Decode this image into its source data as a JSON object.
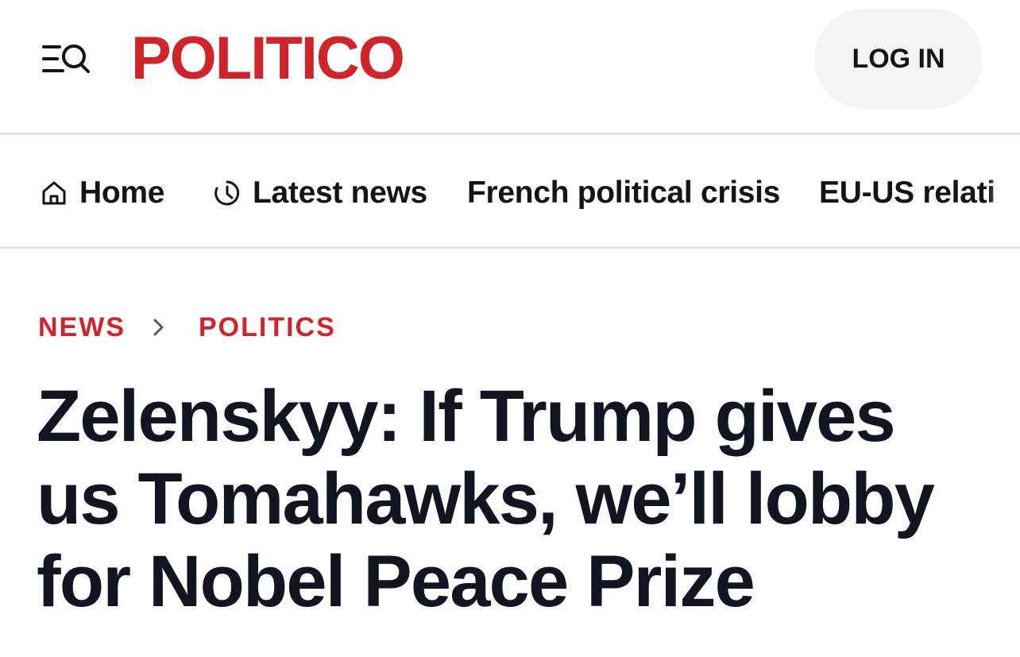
{
  "header": {
    "logo_text": "POLITICO",
    "login_label": "LOG IN",
    "brand_color": "#d0242b",
    "menu_icon": "menu-search-icon"
  },
  "nav": {
    "items": [
      {
        "label": "Home",
        "icon": "home-icon"
      },
      {
        "label": "Latest news",
        "icon": "clock-icon"
      },
      {
        "label": "French political crisis"
      },
      {
        "label": "EU-US relati"
      }
    ]
  },
  "breadcrumb": {
    "items": [
      "NEWS",
      "POLITICS"
    ],
    "separator_icon": "chevron-right-icon"
  },
  "article": {
    "headline": "Zelenskyy: If Trump gives us Tomahawks, we’ll lobby for Nobel Peace Prize"
  }
}
